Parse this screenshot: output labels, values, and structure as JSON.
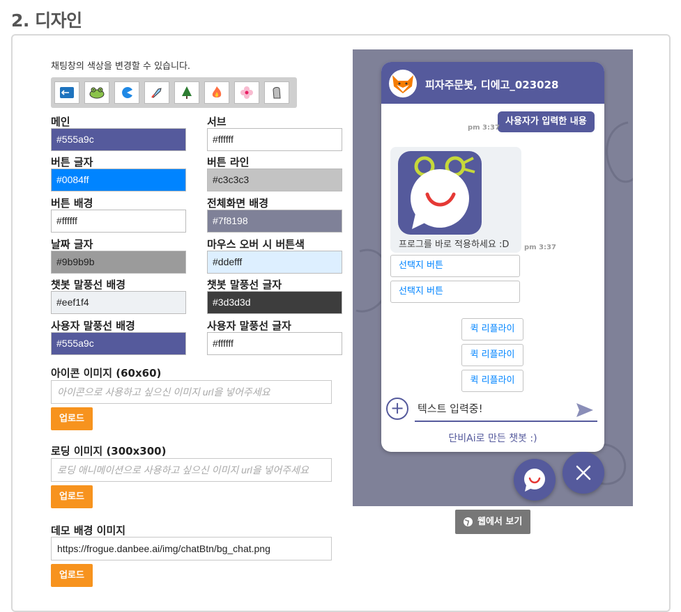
{
  "section_title": "2. 디자인",
  "description": "채팅창의 색상을 변경할 수 있습니다.",
  "themes": [
    "back",
    "frog",
    "pacman",
    "rocket",
    "tree",
    "fire",
    "flower",
    "stone"
  ],
  "colors": [
    {
      "label": "메인",
      "value": "#555a9c",
      "swatch": "#555a9c",
      "text_color": "#ffffff"
    },
    {
      "label": "서브",
      "value": "#ffffff",
      "swatch": "#ffffff",
      "text_color": "#222222"
    },
    {
      "label": "버튼 글자",
      "value": "#0084ff",
      "swatch": "#0084ff",
      "text_color": "#ffffff"
    },
    {
      "label": "버튼 라인",
      "value": "#c3c3c3",
      "swatch": "#c3c3c3",
      "text_color": "#222222"
    },
    {
      "label": "버튼 배경",
      "value": "#ffffff",
      "swatch": "#ffffff",
      "text_color": "#222222"
    },
    {
      "label": "전체화면 배경",
      "value": "#7f8198",
      "swatch": "#7f8198",
      "text_color": "#ffffff"
    },
    {
      "label": "날짜 글자",
      "value": "#9b9b9b",
      "swatch": "#9b9b9b",
      "text_color": "#222222"
    },
    {
      "label": "마우스 오버 시 버튼색",
      "value": "#ddefff",
      "swatch": "#ddefff",
      "text_color": "#222222"
    },
    {
      "label": "챗봇 말풍선 배경",
      "value": "#eef1f4",
      "swatch": "#eef1f4",
      "text_color": "#222222"
    },
    {
      "label": "챗봇 말풍선 글자",
      "value": "#3d3d3d",
      "swatch": "#3d3d3d",
      "text_color": "#ffffff"
    },
    {
      "label": "사용자 말풍선 배경",
      "value": "#555a9c",
      "swatch": "#555a9c",
      "text_color": "#ffffff"
    },
    {
      "label": "사용자 말풍선 글자",
      "value": "#ffffff",
      "swatch": "#ffffff",
      "text_color": "#222222"
    }
  ],
  "icon_image": {
    "label": "아이콘 이미지 (60x60)",
    "placeholder": "아이콘으로 사용하고 싶으신 이미지 url을 넣어주세요",
    "upload": "업로드"
  },
  "loading_image": {
    "label": "로딩 이미지 (300x300)",
    "placeholder": "로딩 애니메이션으로 사용하고 싶으신 이미지 url을 넣어주세요",
    "upload": "업로드"
  },
  "demo_bg": {
    "label": "데모 배경 이미지",
    "value": "https://frogue.danbee.ai/img/chatBtn/bg_chat.png",
    "upload": "업로드"
  },
  "preview": {
    "title": "피자주문봇, 디에고_023028",
    "user_message": "사용자가 입력한 내용",
    "user_time": "pm 3:37",
    "bot_text": "프로그를 바로 적용하세요 :D",
    "bot_time": "pm 3:37",
    "choices": [
      "선택지 버튼",
      "선택지 버튼"
    ],
    "quick_replies": [
      "퀵 리플라이",
      "퀵 리플라이",
      "퀵 리플라이"
    ],
    "input_text": "텍스트 입력중!",
    "footer": "단비Ai로 만든 챗봇 :)"
  },
  "web_view_button": "웹에서 보기"
}
